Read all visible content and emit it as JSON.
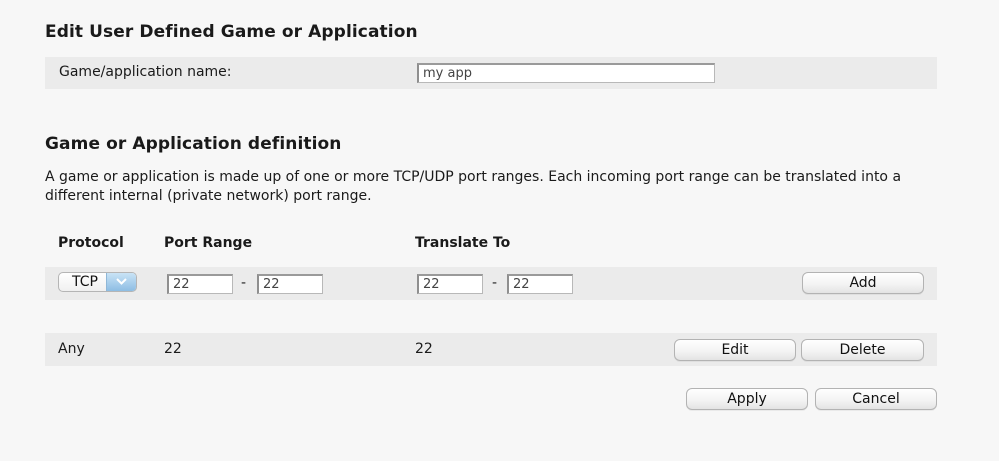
{
  "edit_section": {
    "title": "Edit User Defined Game or Application",
    "name_label": "Game/application name:",
    "name_value": "my app"
  },
  "definition_section": {
    "title": "Game or Application definition",
    "description": "A game or application is made up of one or more TCP/UDP port ranges. Each incoming port range can be translated into a different internal (private network) port range.",
    "columns": {
      "protocol": "Protocol",
      "port_range": "Port Range",
      "translate_to": "Translate To"
    },
    "new_entry": {
      "protocol": "TCP",
      "range_from": "22",
      "range_to": "22",
      "translate_from": "22",
      "translate_to": "22",
      "separator": "-",
      "add_label": "Add"
    },
    "rules": [
      {
        "protocol": "Any",
        "port_range": "22",
        "translate_to": "22",
        "edit_label": "Edit",
        "delete_label": "Delete"
      }
    ]
  },
  "actions": {
    "apply_label": "Apply",
    "cancel_label": "Cancel"
  },
  "colors": {
    "background": "#f7f7f7",
    "band": "#ebebeb",
    "select_arrow": "#a9cfee"
  },
  "icons": {
    "select_arrow": "chevron-down-icon"
  }
}
